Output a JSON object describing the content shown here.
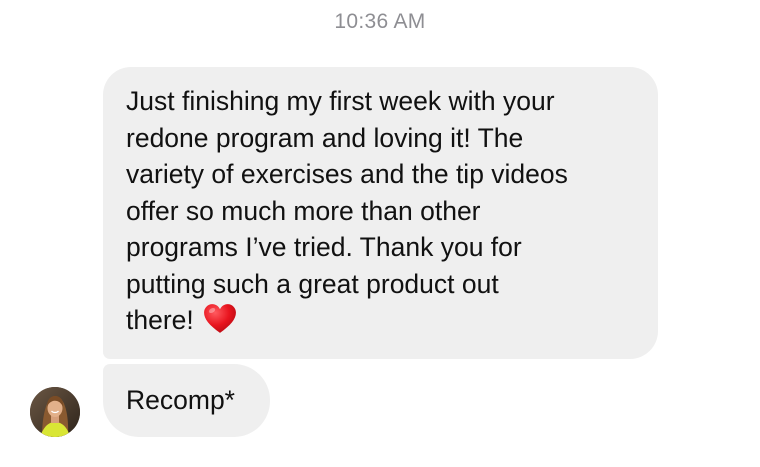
{
  "header": {
    "timestamp": "10:36 AM"
  },
  "messages": [
    {
      "lines": [
        "Just finishing my first week with your",
        "redone program and loving it! The",
        "variety of exercises and the tip videos",
        "offer so much more than other",
        "programs I’ve tried. Thank you for",
        "putting such a great product out",
        "there!"
      ],
      "emoji": "red-heart-icon"
    },
    {
      "text": "Recomp*"
    }
  ],
  "sender": {
    "avatar": "profile-photo"
  },
  "colors": {
    "bubble_background": "#efefef",
    "timestamp_text": "#8e8e93",
    "message_text": "#111111",
    "heart": "#e0121b"
  }
}
